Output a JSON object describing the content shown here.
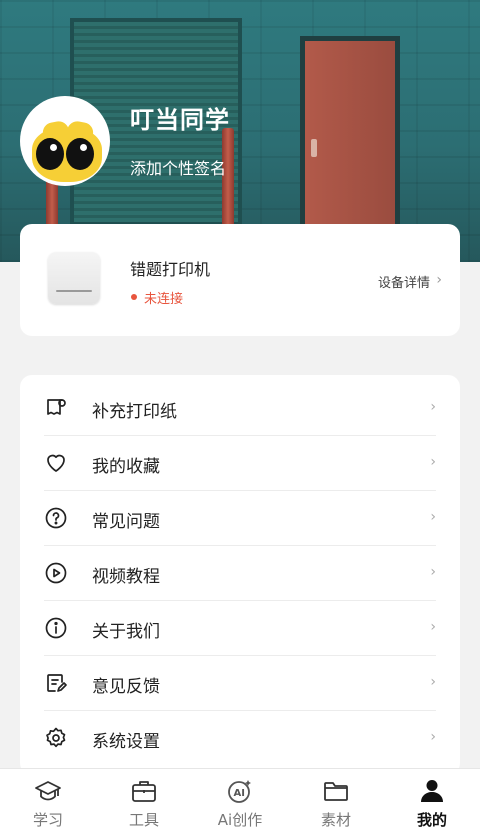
{
  "profile": {
    "username": "叮当同学",
    "signature": "添加个性签名"
  },
  "device": {
    "name": "错题打印机",
    "status": "未连接",
    "detail_link": "设备详情",
    "status_color": "#e8553e"
  },
  "menu": {
    "items": [
      {
        "label": "补充打印纸",
        "icon": "paper-roll-icon"
      },
      {
        "label": "我的收藏",
        "icon": "heart-icon"
      },
      {
        "label": "常见问题",
        "icon": "question-icon"
      },
      {
        "label": "视频教程",
        "icon": "play-icon"
      },
      {
        "label": "关于我们",
        "icon": "info-icon"
      },
      {
        "label": "意见反馈",
        "icon": "feedback-icon"
      },
      {
        "label": "系统设置",
        "icon": "gear-icon"
      }
    ]
  },
  "tabbar": {
    "items": [
      {
        "label": "学习",
        "icon": "graduation-cap-icon",
        "active": false
      },
      {
        "label": "工具",
        "icon": "briefcase-icon",
        "active": false
      },
      {
        "label": "Ai创作",
        "icon": "ai-icon",
        "active": false
      },
      {
        "label": "素材",
        "icon": "folder-icon",
        "active": false
      },
      {
        "label": "我的",
        "icon": "person-icon",
        "active": true
      }
    ]
  }
}
